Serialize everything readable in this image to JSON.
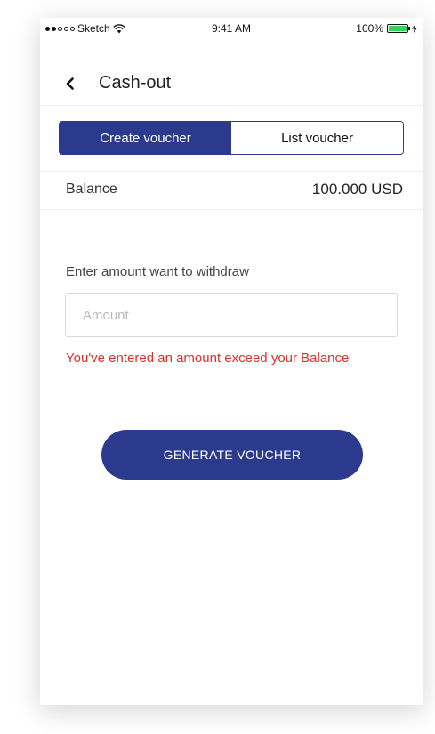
{
  "status_bar": {
    "carrier": "Sketch",
    "time": "9:41 AM",
    "battery": "100%"
  },
  "header": {
    "title": "Cash-out",
    "back_icon": "chevron-left-icon"
  },
  "tabs": [
    {
      "label": "Create voucher",
      "active": true
    },
    {
      "label": "List voucher",
      "active": false
    }
  ],
  "balance": {
    "label": "Balance",
    "value": "100.000 USD"
  },
  "form": {
    "amount_label": "Enter amount want to withdraw",
    "amount_placeholder": "Amount",
    "amount_value": "",
    "error": "You've entered an amount exceed your Balance"
  },
  "actions": {
    "generate_label": "GENERATE VOUCHER"
  },
  "colors": {
    "primary": "#2b3a8c",
    "error": "#d9302e",
    "battery": "#39d353"
  }
}
